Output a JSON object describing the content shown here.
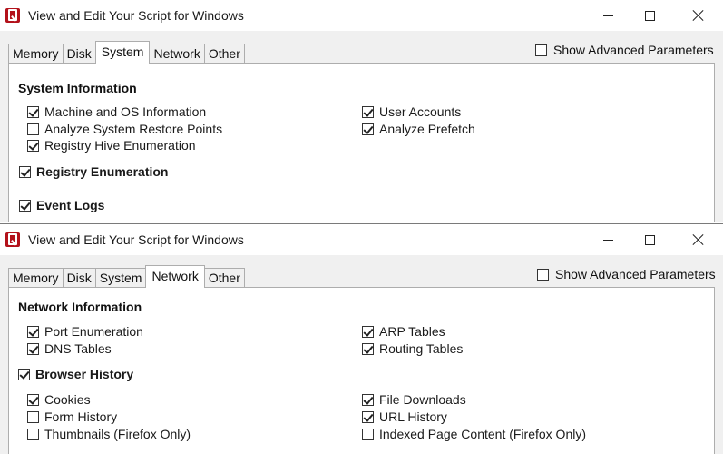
{
  "window1": {
    "title": "View and Edit Your Script for Windows",
    "tabs": [
      "Memory",
      "Disk",
      "System",
      "Network",
      "Other"
    ],
    "active_tab": "System",
    "advanced_label": "Show Advanced Parameters",
    "advanced_checked": false,
    "section_title": "System Information",
    "left_items": [
      {
        "label": "Machine and OS Information",
        "checked": true
      },
      {
        "label": "Analyze System Restore Points",
        "checked": false
      },
      {
        "label": "Registry Hive Enumeration",
        "checked": true
      }
    ],
    "right_items": [
      {
        "label": "User Accounts",
        "checked": true
      },
      {
        "label": "Analyze Prefetch",
        "checked": true
      }
    ],
    "registry_enumeration": {
      "label": "Registry Enumeration",
      "checked": true
    },
    "event_logs": {
      "label": "Event Logs",
      "checked": true
    }
  },
  "window2": {
    "title": "View and Edit Your Script for Windows",
    "tabs": [
      "Memory",
      "Disk",
      "System",
      "Network",
      "Other"
    ],
    "active_tab": "Network",
    "advanced_label": "Show Advanced Parameters",
    "advanced_checked": false,
    "section_title": "Network Information",
    "net_left": [
      {
        "label": "Port Enumeration",
        "checked": true
      },
      {
        "label": "DNS Tables",
        "checked": true
      }
    ],
    "net_right": [
      {
        "label": "ARP Tables",
        "checked": true
      },
      {
        "label": "Routing Tables",
        "checked": true
      }
    ],
    "browser_history": {
      "label": "Browser History",
      "checked": true
    },
    "browser_left": [
      {
        "label": "Cookies",
        "checked": true
      },
      {
        "label": "Form History",
        "checked": false
      },
      {
        "label": "Thumbnails (Firefox Only)",
        "checked": false
      }
    ],
    "browser_right": [
      {
        "label": "File Downloads",
        "checked": true
      },
      {
        "label": "URL History",
        "checked": true
      },
      {
        "label": "Indexed Page Content (Firefox Only)",
        "checked": false
      }
    ]
  }
}
